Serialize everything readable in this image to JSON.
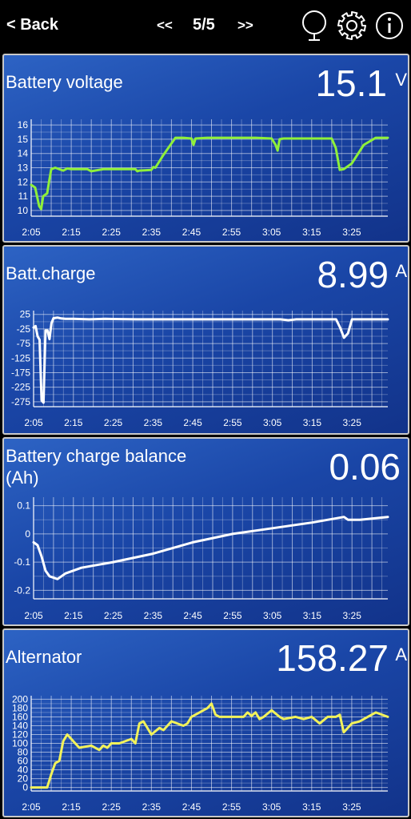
{
  "toolbar": {
    "back_label": "< Back",
    "prev_label": "<<",
    "page_indicator": "5/5",
    "next_label": ">>",
    "icons": [
      "mirror-icon",
      "gear-icon",
      "info-icon"
    ]
  },
  "time_ticks": [
    "2:05",
    "2:15",
    "2:25",
    "2:35",
    "2:45",
    "2:55",
    "3:05",
    "3:15",
    "3:25"
  ],
  "colors": {
    "panel_bg": "#1a46a7",
    "voltage_line": "#8ff03a",
    "charge_line": "#ffffff",
    "balance_line": "#ffffff",
    "alternator_line": "#f2f25a"
  },
  "panels": [
    {
      "title": "Battery voltage",
      "value": "15.1",
      "unit": "V"
    },
    {
      "title": "Batt.charge",
      "value": "8.99",
      "unit": "A"
    },
    {
      "title": "Battery charge balance\n(Ah)",
      "value": "0.06",
      "unit": ""
    },
    {
      "title": "Alternator",
      "value": "158.27",
      "unit": "A"
    }
  ],
  "chart_data": [
    {
      "type": "line",
      "title": "Battery voltage",
      "unit": "V",
      "yticks": [
        "16",
        "15",
        "14",
        "13",
        "12",
        "11",
        "10"
      ],
      "ylim": [
        9.6,
        16.4
      ],
      "xlim": [
        0,
        89
      ],
      "x_unit": "minutes after 2:05",
      "x": [
        0,
        1,
        2,
        2.5,
        3,
        4,
        4.5,
        5,
        6,
        8,
        9,
        10,
        12,
        14,
        15,
        18,
        20,
        22,
        24,
        26,
        26.5,
        27,
        30,
        30.5,
        31,
        33,
        35,
        36,
        38,
        40,
        40.5,
        41,
        44,
        50,
        56,
        60,
        61,
        61.5,
        62,
        63,
        68,
        75,
        76,
        77,
        78,
        80,
        83,
        86,
        89
      ],
      "series": [
        {
          "values": [
            11.8,
            11.6,
            10.3,
            10.1,
            11.0,
            11.2,
            12.1,
            12.9,
            13.0,
            12.8,
            12.95,
            12.9,
            12.9,
            12.9,
            12.75,
            12.9,
            12.9,
            12.9,
            12.9,
            12.9,
            12.75,
            12.8,
            12.85,
            13.05,
            13.0,
            13.9,
            14.7,
            15.1,
            15.1,
            15.05,
            14.6,
            15.05,
            15.1,
            15.1,
            15.1,
            15.05,
            14.6,
            14.2,
            15.0,
            15.05,
            15.05,
            15.05,
            14.4,
            12.85,
            12.9,
            13.3,
            14.6,
            15.1,
            15.1
          ]
        }
      ]
    },
    {
      "type": "line",
      "title": "Batt.charge",
      "unit": "A",
      "yticks": [
        "25",
        "-25",
        "-75",
        "-125",
        "-175",
        "-225",
        "-275"
      ],
      "ylim": [
        -292,
        38
      ],
      "xlim": [
        0,
        89
      ],
      "x_unit": "minutes after 2:05",
      "x": [
        0,
        0.5,
        1,
        1.5,
        2,
        2.5,
        3,
        3.5,
        4,
        4.5,
        5,
        6,
        7,
        8,
        10,
        14,
        18,
        20,
        26,
        30,
        40,
        50,
        60,
        62,
        64,
        66,
        70,
        76,
        77,
        78,
        79,
        80,
        85,
        89
      ],
      "series": [
        {
          "values": [
            -20,
            -15,
            -50,
            -62,
            -270,
            -278,
            -30,
            -30,
            -60,
            -5,
            12,
            14,
            11,
            10,
            10,
            8,
            10,
            9,
            8,
            8,
            8,
            8,
            8,
            8,
            5,
            8,
            8,
            8,
            -20,
            -55,
            -40,
            8,
            8,
            8
          ]
        }
      ]
    },
    {
      "type": "line",
      "title": "Battery charge balance (Ah)",
      "unit": "Ah",
      "yticks": [
        "0.1",
        "0",
        "-0.1",
        "-0.2"
      ],
      "ylim": [
        -0.23,
        0.13
      ],
      "xlim": [
        0,
        89
      ],
      "x_unit": "minutes after 2:05",
      "x": [
        0,
        1,
        2,
        3,
        4,
        6,
        8,
        12,
        20,
        30,
        40,
        50,
        60,
        70,
        78,
        79,
        82,
        89
      ],
      "series": [
        {
          "values": [
            -0.03,
            -0.04,
            -0.08,
            -0.13,
            -0.15,
            -0.16,
            -0.14,
            -0.12,
            -0.1,
            -0.07,
            -0.03,
            0.0,
            0.02,
            0.04,
            0.06,
            0.05,
            0.05,
            0.06
          ]
        }
      ]
    },
    {
      "type": "line",
      "title": "Alternator",
      "unit": "A",
      "yticks": [
        "200",
        "180",
        "160",
        "140",
        "120",
        "100",
        "80",
        "60",
        "40",
        "20",
        "0"
      ],
      "ylim": [
        -8,
        208
      ],
      "xlim": [
        0,
        89
      ],
      "x_unit": "minutes after 2:05",
      "x": [
        0,
        2,
        4,
        5,
        6,
        7,
        8,
        9,
        12,
        15,
        17,
        18,
        19,
        20,
        22,
        25,
        26,
        27,
        28,
        30,
        32,
        33,
        35,
        38,
        39,
        40,
        42,
        44,
        45,
        46,
        47,
        50,
        53,
        54,
        55,
        56,
        57,
        58,
        60,
        62,
        63,
        66,
        68,
        70,
        72,
        74,
        76,
        77,
        78,
        80,
        82,
        84,
        86,
        89
      ],
      "series": [
        {
          "values": [
            0,
            0,
            0,
            30,
            55,
            60,
            105,
            120,
            90,
            95,
            85,
            95,
            90,
            100,
            100,
            110,
            100,
            145,
            150,
            120,
            135,
            130,
            150,
            140,
            145,
            160,
            170,
            180,
            190,
            165,
            160,
            160,
            160,
            170,
            162,
            170,
            155,
            160,
            175,
            160,
            155,
            160,
            155,
            160,
            145,
            160,
            160,
            165,
            125,
            145,
            150,
            160,
            170,
            160
          ]
        }
      ]
    }
  ]
}
